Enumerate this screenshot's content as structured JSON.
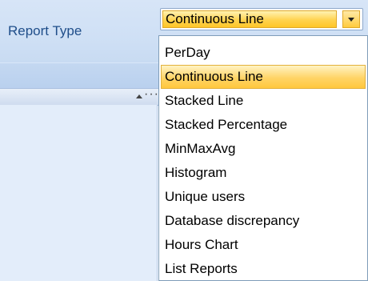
{
  "report_type": {
    "label": "Report Type",
    "selected_value": "Continuous Line",
    "options": [
      "PerDay",
      "Continuous Line",
      "Stacked Line",
      "Stacked Percentage",
      "MinMaxAvg",
      "Histogram",
      "Unique users",
      "Database discrepancy",
      "Hours Chart",
      "List Reports"
    ],
    "selected_index": 1
  },
  "grid": {
    "header_dots": "····"
  },
  "colors": {
    "accent_highlight": "#ffd34f",
    "panel_blue": "#cfe0f5",
    "label_blue": "#1f4e8a"
  },
  "icons": {
    "dropdown": "chevron-down-icon",
    "sort": "sort-ascending-icon"
  }
}
